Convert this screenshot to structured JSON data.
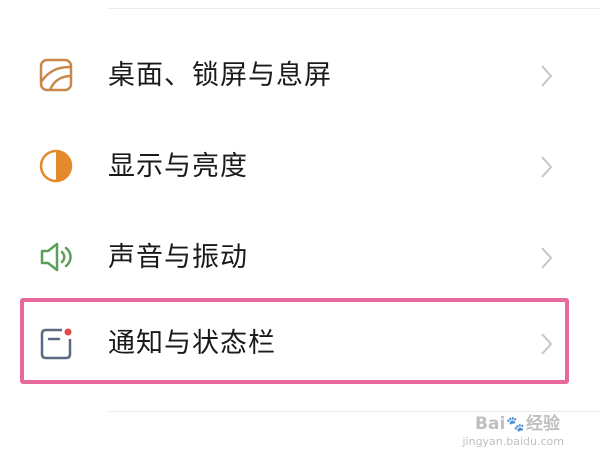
{
  "settings": {
    "items": [
      {
        "label": "桌面、锁屏与息屏",
        "icon": "wallpaper-icon"
      },
      {
        "label": "显示与亮度",
        "icon": "brightness-icon"
      },
      {
        "label": "声音与振动",
        "icon": "speaker-icon"
      },
      {
        "label": "通知与状态栏",
        "icon": "notification-icon"
      }
    ]
  },
  "watermark": {
    "brand_left": "Bai",
    "brand_right": "经验",
    "url": "jingyan.baidu.com"
  },
  "colors": {
    "highlight": "#e86a9d",
    "wallpaper_icon": "#c9884a",
    "brightness_icon": "#e58a2b",
    "speaker_icon": "#5aa05a",
    "notification_icon": "#5a6a82",
    "notification_dot": "#e24a4a"
  }
}
